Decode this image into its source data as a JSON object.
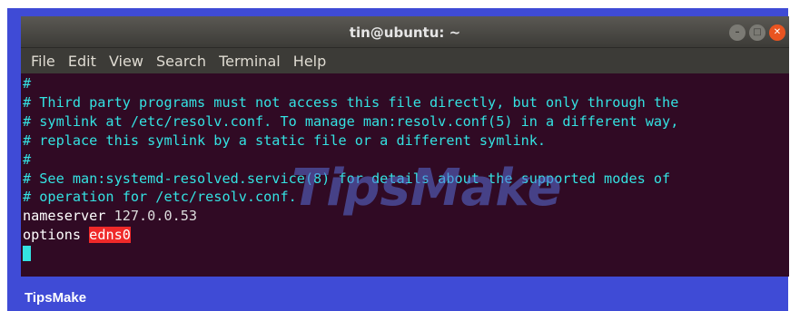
{
  "window": {
    "title": "tin@ubuntu: ~",
    "controls": [
      "minimize",
      "maximize",
      "close"
    ]
  },
  "menu": {
    "items": [
      "File",
      "Edit",
      "View",
      "Search",
      "Terminal",
      "Help"
    ]
  },
  "terminal": {
    "lines": [
      "#",
      "# Third party programs must not access this file directly, but only through the",
      "# symlink at /etc/resolv.conf. To manage man:resolv.conf(5) in a different way,",
      "# replace this symlink by a static file or a different symlink.",
      "#",
      "# See man:systemd-resolved.service(8) for details about the supported modes of",
      "# operation for /etc/resolv.conf.",
      ""
    ],
    "nameserver_key": "nameserver",
    "nameserver_value": " 127.0.0.53",
    "options_key": "options",
    "options_value": "edns0"
  },
  "watermark": {
    "text": "TipsMake"
  },
  "footer": {
    "brand": "TipsMake"
  },
  "colors": {
    "frame": "#3f4bd6",
    "terminal_bg": "#300a24",
    "comment": "#34e2e2",
    "highlight": "#ef2929",
    "close_button": "#e95420"
  }
}
